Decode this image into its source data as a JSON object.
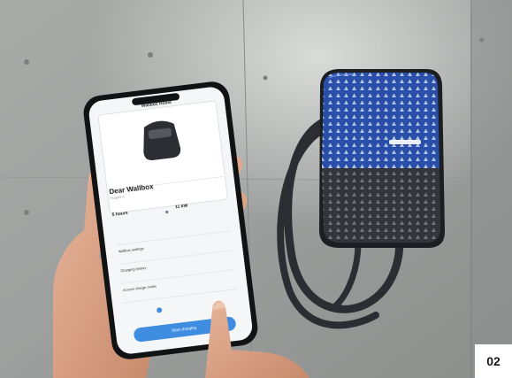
{
  "image_number": "02",
  "phone_app": {
    "title": "Wallbox Home",
    "vehicle_name": "Dear Wallbox",
    "vehicle_subtitle": "Plugged in",
    "stat_time": "5 hours",
    "stat_energy": "11 kW",
    "menu": [
      "Wallbox settings",
      "Charging history",
      "Access charge codes"
    ],
    "cta_label": "Start charging"
  },
  "colors": {
    "wall": "#9a9c9b",
    "wallbox_blue": "#2a4fa8",
    "wallbox_dark": "#2e2f33",
    "app_accent": "#3f8de0"
  }
}
